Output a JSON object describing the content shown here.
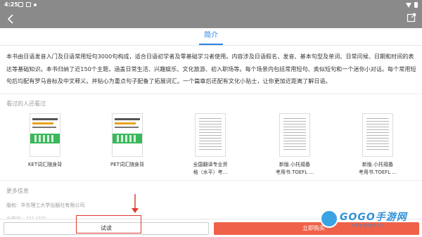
{
  "status_bar": {
    "time": "4:25"
  },
  "tabs": {
    "intro_label": "简介"
  },
  "intro": {
    "text": "本书由日语发音入门及日语常用短句3000句构成，适合日语初学者及零基础学习者使用。内容涉及日语假名、发音、基本句型及单词、日常问候、日期和时间的表达等基础知识。本书归纳了近150个主题，涵盖日常生活、兴趣娱乐、文化旅游、初入职场等。每个场景内包括常用短句、类似短句和一个迷你小对话。每个常用短句后均配有罗马音标及中文释义。并贴心为重点句子配备了拓展词汇。一个篇章后还配有文化小贴士，让你更加近距离了解日语。"
  },
  "also_viewed": {
    "title": "看过的人还看过",
    "books": [
      {
        "title_line1": "KET词汇随身背",
        "title_line2": "",
        "cover": "green"
      },
      {
        "title_line1": "PET词汇随身背",
        "title_line2": "",
        "cover": "green"
      },
      {
        "title_line1": "全国翻译专业资",
        "title_line2": "格（水平）考...",
        "cover": "doc"
      },
      {
        "title_line1": "新版.小托福备",
        "title_line2": "考用书.TOEFL ...",
        "cover": "doc"
      },
      {
        "title_line1": "新版.小托福备",
        "title_line2": "考用书.TOEFL ...",
        "cover": "doc"
      }
    ]
  },
  "more_info": {
    "title": "更多信息",
    "copyright_label": "版权:",
    "copyright_value": "华东理工大学出版社有限公司",
    "partial_line": "出版社：??? ????"
  },
  "bottom_bar": {
    "try_label": "试读",
    "buy_label": "立即购买"
  },
  "watermark": {
    "brand": "GOGO手游网",
    "domain": "www.gogo.cn"
  },
  "colors": {
    "accent": "#2a82e4",
    "buy": "#ef6148",
    "highlight": "#e03a2f",
    "bar": "#8a8a8a"
  }
}
